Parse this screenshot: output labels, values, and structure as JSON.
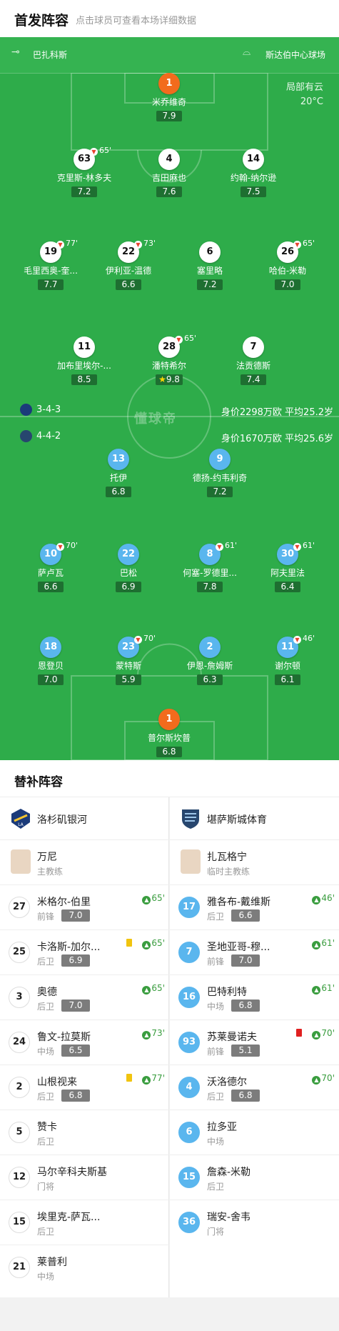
{
  "header": {
    "title": "首发阵容",
    "subtitle": "点击球员可查看本场详细数据"
  },
  "venue": {
    "home_team": "巴扎科斯",
    "stadium": "斯达伯中心球场"
  },
  "weather": {
    "condition": "局部有云",
    "temp": "20°C"
  },
  "watermark": "懂球帝",
  "home_formation": {
    "formation": "3-4-3",
    "value": "身价2298万欧 平均25.2岁"
  },
  "away_formation": {
    "formation": "4-4-2",
    "value": "身价1670万欧 平均25.6岁"
  },
  "home_players": [
    {
      "num": "1",
      "name": "米乔维奇",
      "rating": "7.9"
    },
    {
      "num": "63",
      "name": "克里斯-林多夫",
      "rating": "7.2",
      "sub": "65'"
    },
    {
      "num": "4",
      "name": "吉田麻也",
      "rating": "7.6"
    },
    {
      "num": "14",
      "name": "约翰-纳尔逊",
      "rating": "7.5"
    },
    {
      "num": "19",
      "name": "毛里西奥-奎...",
      "rating": "7.7",
      "sub": "77'"
    },
    {
      "num": "22",
      "name": "伊利亚-温德",
      "rating": "6.6",
      "sub": "73'"
    },
    {
      "num": "6",
      "name": "塞里略",
      "rating": "7.2"
    },
    {
      "num": "26",
      "name": "哈伯-米勒",
      "rating": "7.0",
      "sub": "65'"
    },
    {
      "num": "11",
      "name": "加布里埃尔-...",
      "rating": "8.5"
    },
    {
      "num": "28",
      "name": "潘特希尔",
      "rating": "9.8",
      "sub": "65'"
    },
    {
      "num": "7",
      "name": "法贡德斯",
      "rating": "7.4"
    }
  ],
  "away_players": [
    {
      "num": "13",
      "name": "托伊",
      "rating": "6.8"
    },
    {
      "num": "9",
      "name": "德扬-约韦利奇",
      "rating": "7.2"
    },
    {
      "num": "10",
      "name": "萨卢瓦",
      "rating": "6.6",
      "sub": "70'"
    },
    {
      "num": "22",
      "name": "巴松",
      "rating": "6.9"
    },
    {
      "num": "8",
      "name": "何塞-罗德里...",
      "rating": "7.8",
      "sub": "61'"
    },
    {
      "num": "30",
      "name": "阿夫里法",
      "rating": "6.4",
      "sub": "61'"
    },
    {
      "num": "18",
      "name": "恩登贝",
      "rating": "7.0"
    },
    {
      "num": "23",
      "name": "蒙特斯",
      "rating": "5.9",
      "sub": "70'"
    },
    {
      "num": "2",
      "name": "伊恩-詹姆斯",
      "rating": "6.3"
    },
    {
      "num": "11",
      "name": "谢尔顿",
      "rating": "6.1",
      "sub": "46'"
    },
    {
      "num": "1",
      "name": "普尔斯坎普",
      "rating": "6.8"
    }
  ],
  "bench": {
    "title": "替补阵容",
    "home": {
      "team": "洛杉矶银河",
      "coach": "万尼",
      "coach_role": "主教练",
      "subs": [
        {
          "num": "27",
          "name": "米格尔-伯里",
          "pos": "前锋",
          "rating": "7.0",
          "in": "65'"
        },
        {
          "num": "25",
          "name": "卡洛斯-加尔...",
          "pos": "后卫",
          "rating": "6.9",
          "in": "65'"
        },
        {
          "num": "3",
          "name": "奥德",
          "pos": "后卫",
          "rating": "7.0",
          "in": "65'"
        },
        {
          "num": "24",
          "name": "鲁文-拉莫斯",
          "pos": "中场",
          "rating": "6.5",
          "in": "73'"
        },
        {
          "num": "2",
          "name": "山根视来",
          "pos": "后卫",
          "rating": "6.8",
          "in": "77'"
        },
        {
          "num": "5",
          "name": "赞卡",
          "pos": "后卫"
        },
        {
          "num": "12",
          "name": "马尔辛科夫斯基",
          "pos": "门将"
        },
        {
          "num": "15",
          "name": "埃里克-萨瓦...",
          "pos": "后卫"
        },
        {
          "num": "21",
          "name": "莱普利",
          "pos": "中场"
        }
      ]
    },
    "away": {
      "team": "堪萨斯城体育",
      "coach": "扎瓦格宁",
      "coach_role": "临时主教练",
      "subs": [
        {
          "num": "17",
          "name": "雅各布-戴维斯",
          "pos": "后卫",
          "rating": "6.6",
          "in": "46'"
        },
        {
          "num": "7",
          "name": "圣地亚哥-穆...",
          "pos": "前锋",
          "rating": "7.0",
          "in": "61'"
        },
        {
          "num": "16",
          "name": "巴特利特",
          "pos": "中场",
          "rating": "6.8",
          "in": "61'"
        },
        {
          "num": "93",
          "name": "苏莱曼诺夫",
          "pos": "前锋",
          "rating": "5.1",
          "in": "70'"
        },
        {
          "num": "4",
          "name": "沃洛德尔",
          "pos": "后卫",
          "rating": "6.8",
          "in": "70'"
        },
        {
          "num": "6",
          "name": "拉多亚",
          "pos": "中场"
        },
        {
          "num": "15",
          "name": "詹森-米勒",
          "pos": "后卫"
        },
        {
          "num": "36",
          "name": "瑞安-舍韦",
          "pos": "门将"
        }
      ]
    }
  },
  "colors": {
    "pitch": "#2eac4a",
    "home_shirt": "#ffffff",
    "away_shirt": "#5ab6ee",
    "keeper": "#f26b1d"
  }
}
